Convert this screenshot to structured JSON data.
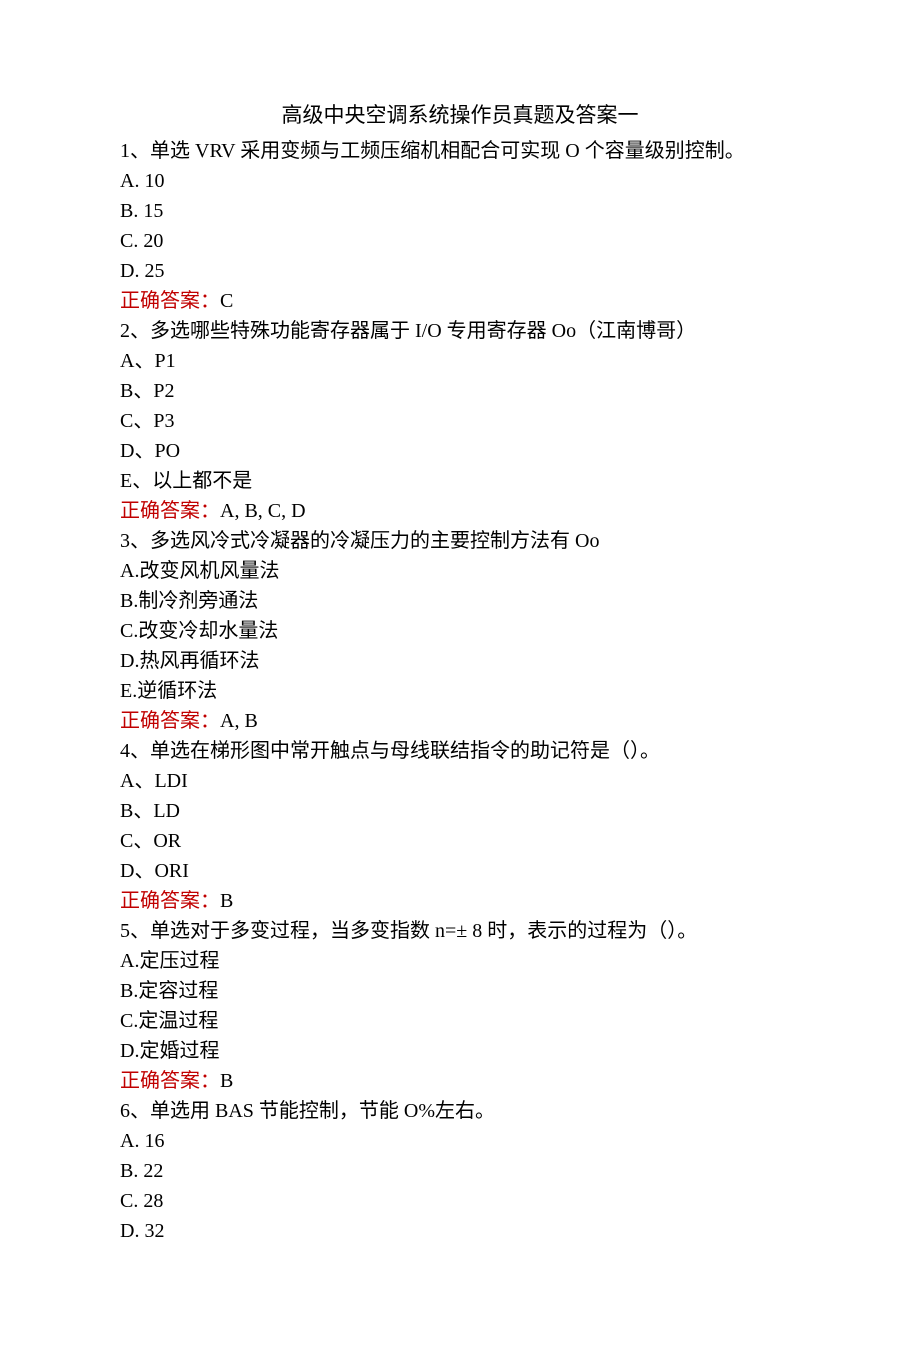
{
  "title": "高级中央空调系统操作员真题及答案一",
  "answerLabel": "正确答案：",
  "questions": [
    {
      "prompt": "1、单选 VRV 采用变频与工频压缩机相配合可实现 O 个容量级别控制。",
      "options": [
        "A. 10",
        "B. 15",
        "C. 20",
        "D. 25"
      ],
      "answer": "C"
    },
    {
      "prompt": "2、多选哪些特殊功能寄存器属于 I/O 专用寄存器 Oo（江南博哥）",
      "options": [
        "A、P1",
        "B、P2",
        "C、P3",
        "D、PO",
        "E、以上都不是"
      ],
      "answer": "A, B, C, D"
    },
    {
      "prompt": "3、多选风冷式冷凝器的冷凝压力的主要控制方法有 Oo",
      "options": [
        "A.改变风机风量法",
        "B.制冷剂旁通法",
        "C.改变冷却水量法",
        "D.热风再循环法",
        "E.逆循环法"
      ],
      "answer": "A, B"
    },
    {
      "prompt": "4、单选在梯形图中常开触点与母线联结指令的助记符是（）。",
      "options": [
        "A、LDI",
        "B、LD",
        "C、OR",
        "D、ORI"
      ],
      "answer": "B"
    },
    {
      "prompt": "5、单选对于多变过程，当多变指数 n=± 8 时，表示的过程为（）。",
      "options": [
        "A.定压过程",
        "B.定容过程",
        "C.定温过程",
        "D.定婚过程"
      ],
      "answer": "B"
    },
    {
      "prompt": "6、单选用 BAS 节能控制，节能 O%左右。",
      "options": [
        "A. 16",
        "B. 22",
        "C. 28",
        "D. 32"
      ],
      "answer": ""
    }
  ]
}
